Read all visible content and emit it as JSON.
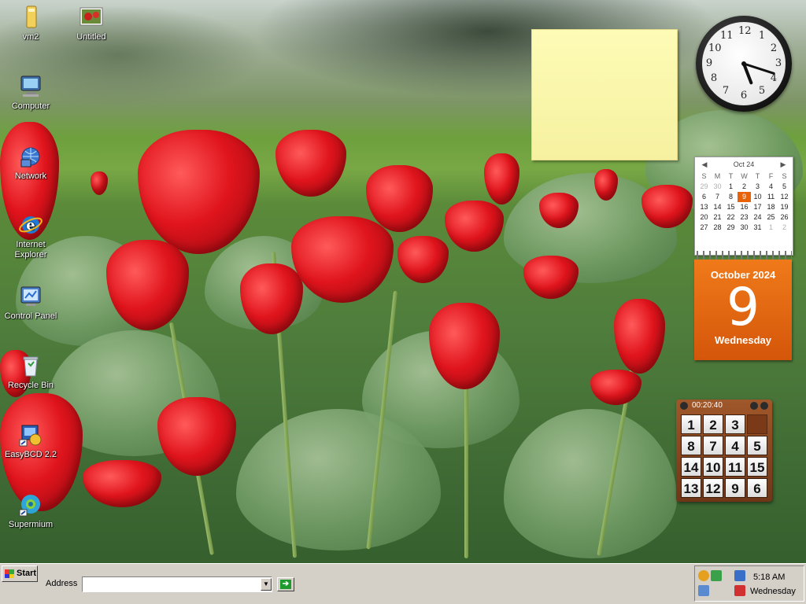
{
  "desktop_icons": [
    {
      "label": "vm2",
      "icon": "folder-icon"
    },
    {
      "label": "Untitled",
      "icon": "image-file-icon"
    },
    {
      "label": "Computer",
      "icon": "computer-icon"
    },
    {
      "label": "Network",
      "icon": "network-icon"
    },
    {
      "label": "Internet Explorer",
      "icon": "internet-explorer-icon"
    },
    {
      "label": "Control Panel",
      "icon": "control-panel-icon"
    },
    {
      "label": "Recycle Bin",
      "icon": "recycle-bin-icon"
    },
    {
      "label": "EasyBCD 2.2",
      "icon": "easybcd-icon"
    },
    {
      "label": "Supermium",
      "icon": "supermium-icon"
    }
  ],
  "clock_gadget": {
    "numbers": [
      "12",
      "1",
      "2",
      "3",
      "4",
      "5",
      "6",
      "7",
      "8",
      "9",
      "10",
      "11"
    ],
    "hour": 5,
    "minute": 18
  },
  "calendar": {
    "month_label": "Oct 24",
    "prev": "◀",
    "next": "▶",
    "weekdays": [
      "S",
      "M",
      "T",
      "W",
      "T",
      "F",
      "S"
    ],
    "days": [
      [
        "29",
        "30",
        "1",
        "2",
        "3",
        "4",
        "5"
      ],
      [
        "6",
        "7",
        "8",
        "9",
        "10",
        "11",
        "12"
      ],
      [
        "13",
        "14",
        "15",
        "16",
        "17",
        "18",
        "19"
      ],
      [
        "20",
        "21",
        "22",
        "23",
        "24",
        "25",
        "26"
      ],
      [
        "27",
        "28",
        "29",
        "30",
        "31",
        "1",
        "2"
      ]
    ],
    "today": "9",
    "month_year": "October 2024",
    "day_number": "9",
    "weekday": "Wednesday"
  },
  "puzzle": {
    "timer": "00:20:40",
    "tiles": [
      "1",
      "2",
      "3",
      "",
      "8",
      "7",
      "4",
      "5",
      "14",
      "10",
      "11",
      "15",
      "13",
      "12",
      "9",
      "6"
    ]
  },
  "taskbar": {
    "start_label": "Start",
    "address_label": "Address",
    "address_value": "",
    "time": "5:18 AM",
    "day": "Wednesday"
  },
  "colors": {
    "taskbar": "#d4d0c8",
    "calendar_accent": "#e8620a",
    "sticky_note": "#fdfbb6"
  }
}
